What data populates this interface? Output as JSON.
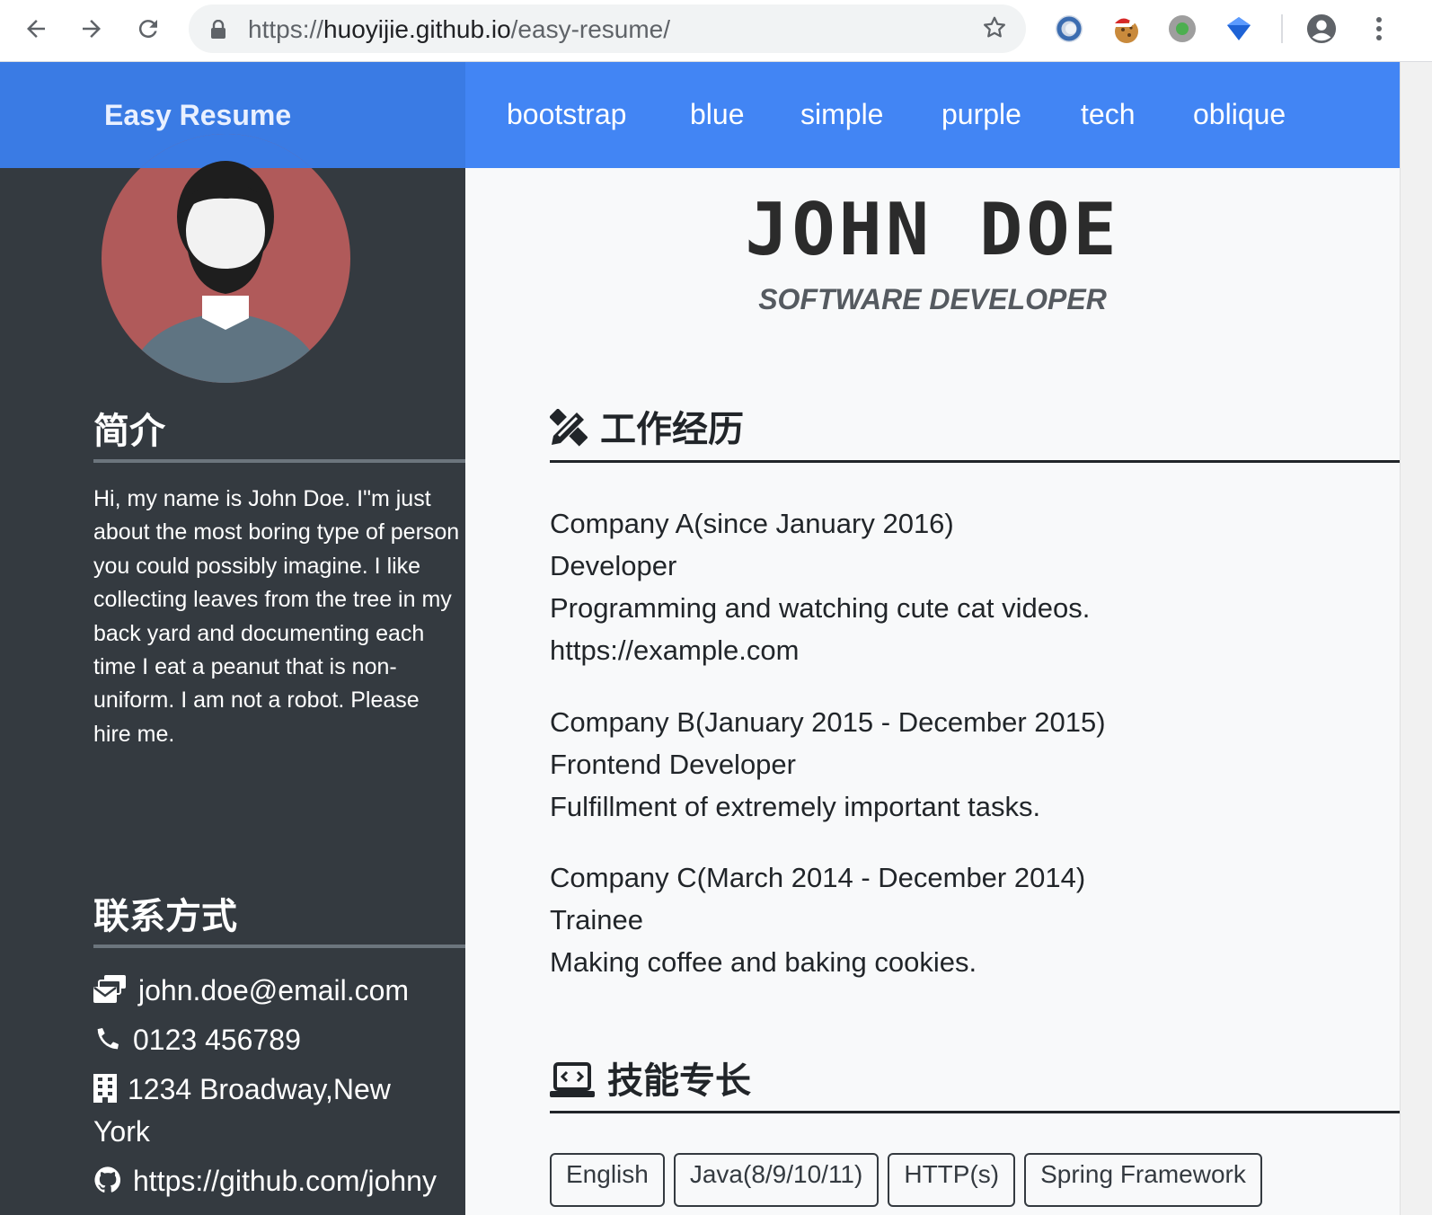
{
  "browser": {
    "url_prefix": "https://",
    "url_host": "huoyijie.github.io",
    "url_path": "/easy-resume/",
    "icons": [
      "back-icon",
      "forward-icon",
      "reload-icon",
      "lock-icon",
      "star-icon",
      "profile-icon",
      "menu-icon"
    ]
  },
  "nav": {
    "brand": "Easy Resume",
    "links": [
      "bootstrap",
      "blue",
      "simple",
      "purple",
      "tech",
      "oblique"
    ]
  },
  "sidebar": {
    "about_title": "简介",
    "about_text": "Hi, my name is John Doe. I\"m just about the most boring type of person you could possibly imagine. I like collecting leaves from the tree in my back yard and documenting each time I eat a peanut that is non-uniform. I am not a robot. Please hire me.",
    "contact_title": "联系方式",
    "email": "john.doe@email.com",
    "phone": "0123 456789",
    "address_line1": "1234 Broadway,New",
    "address_line2": "York",
    "github": "https://github.com/johny"
  },
  "main": {
    "name": "JOHN DOE",
    "role": "SOFTWARE DEVELOPER",
    "work_title": "工作经历",
    "jobs": [
      {
        "company": "Company A(since January 2016)",
        "position": "Developer",
        "description": "Programming and watching cute cat videos.",
        "link": "https://example.com"
      },
      {
        "company": "Company B(January 2015 - December 2015)",
        "position": "Frontend Developer",
        "description": "Fulfillment of extremely important tasks."
      },
      {
        "company": "Company C(March 2014 - December 2014)",
        "position": "Trainee",
        "description": "Making coffee and baking cookies."
      }
    ],
    "skills_title": "技能专长",
    "skills": [
      "English",
      "Java(8/9/10/11)",
      "HTTP(s)",
      "Spring Framework"
    ]
  },
  "colors": {
    "nav_blue": "#4285f4",
    "brand_blue": "#3a7be4",
    "sidebar_dark": "#343a40",
    "avatar_red": "#b05a5a"
  }
}
